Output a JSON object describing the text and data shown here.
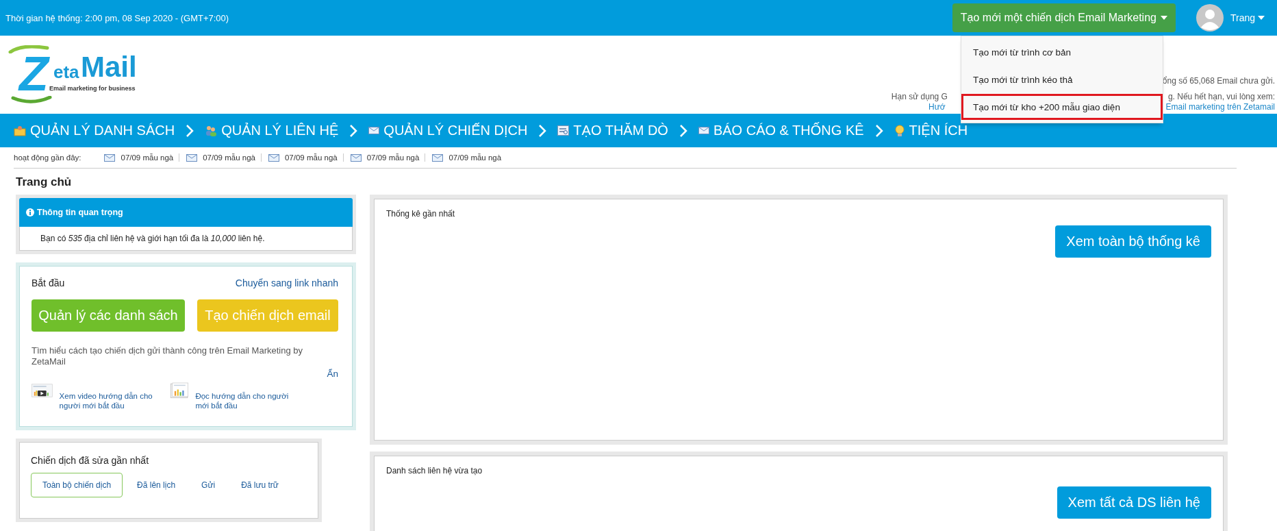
{
  "top_bar": {
    "system_time": "Thời gian hệ thống: 2:00 pm, 08 Sep 2020 - (GMT+7:00)",
    "create_button": "Tạo mới một chiến dịch Email Marketing",
    "user_name": "Trang"
  },
  "create_menu": {
    "items": [
      {
        "label": "Tạo mới từ trình cơ bản",
        "highlighted": false
      },
      {
        "label": "Tạo mới từ trình kéo thả",
        "highlighted": false
      },
      {
        "label": "Tạo mới từ kho +200 mẫu giao diện",
        "highlighted": true
      }
    ]
  },
  "logo": {
    "initial": "Z",
    "rest": "eta",
    "name": "Mail",
    "tagline": "Email marketing for business"
  },
  "account_notes": [
    {
      "right": "ổng số 65,068 Email chưa gửi.",
      "kind": "text"
    },
    {
      "left": "Hạn sử dụng G",
      "right": "g. Nếu hết hạn, vui lòng xem:",
      "kind": "text"
    },
    {
      "left": "Hướ",
      "right": "Email marketing trên Zetamail",
      "kind": "link"
    }
  ],
  "nav": [
    {
      "label": "QUẢN LÝ DANH SÁCH",
      "kind": "folder"
    },
    {
      "label": "QUẢN LÝ LIÊN HỆ",
      "kind": "people"
    },
    {
      "label": "QUẢN LÝ CHIẾN DỊCH",
      "kind": "mail"
    },
    {
      "label": "TẠO THĂM DÒ",
      "kind": "form"
    },
    {
      "label": "BÁO CÁO & THỐNG KÊ",
      "kind": "mail"
    },
    {
      "label": "TIỆN ÍCH",
      "kind": "bulb"
    }
  ],
  "recent_activity": {
    "label": "hoạt động gần đây:",
    "items": [
      "07/09 mẫu ngà",
      "07/09 mẫu ngà",
      "07/09 mẫu ngà",
      "07/09 mẫu ngà",
      "07/09 mẫu ngà"
    ]
  },
  "page_title": "Trang chủ",
  "important_info": {
    "title": "Thông tin quan trọng",
    "text": "Bạn có *535* địa chỉ liên hệ và giới hạn tối đa là *10,000* liên hệ."
  },
  "getting_started": {
    "title": "Bắt đầu",
    "quick_link": "Chuyển sang link nhanh",
    "buttons": [
      {
        "label": "Quản lý các danh sách",
        "kind": "green"
      },
      {
        "label": "Tạo chiến dịch email",
        "kind": "yellow"
      }
    ],
    "description": "Tìm hiểu cách tạo chiến dịch gửi thành công trên Email Marketing by ZetaMail",
    "hide": "Ẩn",
    "guides": [
      {
        "label": "Xem video hướng dẫn cho người mới bắt đầu",
        "kind": "video"
      },
      {
        "label": "Đọc hướng dẫn cho người mới bắt đầu",
        "kind": "document"
      }
    ]
  },
  "recent_campaigns": {
    "title": "Chiến dịch đã sửa gần nhất",
    "tabs": [
      {
        "label": "Toàn bộ chiến dịch",
        "selected": true
      },
      {
        "label": "Đã lên lịch",
        "selected": false
      },
      {
        "label": "Gửi",
        "selected": false
      },
      {
        "label": "Đã lưu trữ",
        "selected": false
      }
    ]
  },
  "latest_stats": {
    "title": "Thống kê gần nhất",
    "button": "Xem toàn bộ thống kê"
  },
  "new_contact_lists": {
    "title": "Danh sách liên hệ vừa tạo",
    "button": "Xem tất cả DS liên hệ"
  }
}
